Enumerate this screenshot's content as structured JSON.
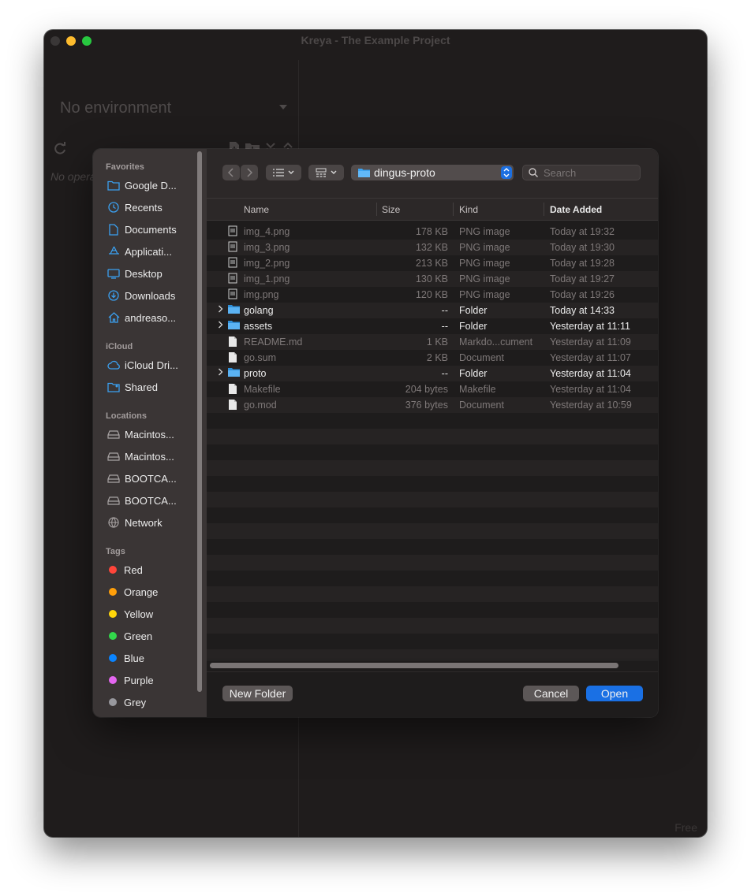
{
  "app": {
    "title": "Kreya - The Example Project",
    "environment": "No environment",
    "no_operations": "No operations",
    "plan_label": "Free"
  },
  "dialog": {
    "sidebar": {
      "favorites_heading": "Favorites",
      "favorites": [
        {
          "label": "Google D...",
          "icon": "folder-icon"
        },
        {
          "label": "Recents",
          "icon": "clock-icon"
        },
        {
          "label": "Documents",
          "icon": "document-icon"
        },
        {
          "label": "Applicati...",
          "icon": "applications-icon"
        },
        {
          "label": "Desktop",
          "icon": "desktop-icon"
        },
        {
          "label": "Downloads",
          "icon": "download-icon"
        },
        {
          "label": "andreaso...",
          "icon": "home-icon"
        }
      ],
      "icloud_heading": "iCloud",
      "icloud": [
        {
          "label": "iCloud Dri...",
          "icon": "cloud-icon"
        },
        {
          "label": "Shared",
          "icon": "shared-folder-icon"
        }
      ],
      "locations_heading": "Locations",
      "locations": [
        {
          "label": "Macintos...",
          "icon": "drive-icon"
        },
        {
          "label": "Macintos...",
          "icon": "drive-icon"
        },
        {
          "label": "BOOTCA...",
          "icon": "drive-icon"
        },
        {
          "label": "BOOTCA...",
          "icon": "drive-icon"
        },
        {
          "label": "Network",
          "icon": "globe-icon"
        }
      ],
      "tags_heading": "Tags",
      "tags": [
        {
          "label": "Red",
          "color": "#ff453a"
        },
        {
          "label": "Orange",
          "color": "#ff9f0a"
        },
        {
          "label": "Yellow",
          "color": "#ffd60a"
        },
        {
          "label": "Green",
          "color": "#32d74b"
        },
        {
          "label": "Blue",
          "color": "#0a84ff"
        },
        {
          "label": "Purple",
          "color": "#e466f0"
        },
        {
          "label": "Grey",
          "color": "#98989d"
        }
      ]
    },
    "toolbar": {
      "current_folder": "dingus-proto",
      "search_placeholder": "Search"
    },
    "columns": {
      "name": "Name",
      "size": "Size",
      "kind": "Kind",
      "date_added": "Date Added"
    },
    "files": [
      {
        "name": "img_4.png",
        "size": "178 KB",
        "kind": "PNG image",
        "date": "Today at 19:32",
        "type": "image"
      },
      {
        "name": "img_3.png",
        "size": "132 KB",
        "kind": "PNG image",
        "date": "Today at 19:30",
        "type": "image"
      },
      {
        "name": "img_2.png",
        "size": "213 KB",
        "kind": "PNG image",
        "date": "Today at 19:28",
        "type": "image"
      },
      {
        "name": "img_1.png",
        "size": "130 KB",
        "kind": "PNG image",
        "date": "Today at 19:27",
        "type": "image"
      },
      {
        "name": "img.png",
        "size": "120 KB",
        "kind": "PNG image",
        "date": "Today at 19:26",
        "type": "image"
      },
      {
        "name": "golang",
        "size": "--",
        "kind": "Folder",
        "date": "Today at 14:33",
        "type": "folder"
      },
      {
        "name": "assets",
        "size": "--",
        "kind": "Folder",
        "date": "Yesterday at 11:11",
        "type": "folder"
      },
      {
        "name": "README.md",
        "size": "1 KB",
        "kind": "Markdo...cument",
        "date": "Yesterday at 11:09",
        "type": "doc"
      },
      {
        "name": "go.sum",
        "size": "2 KB",
        "kind": "Document",
        "date": "Yesterday at 11:07",
        "type": "doc"
      },
      {
        "name": "proto",
        "size": "--",
        "kind": "Folder",
        "date": "Yesterday at 11:04",
        "type": "folder"
      },
      {
        "name": "Makefile",
        "size": "204 bytes",
        "kind": "Makefile",
        "date": "Yesterday at 11:04",
        "type": "doc"
      },
      {
        "name": "go.mod",
        "size": "376 bytes",
        "kind": "Document",
        "date": "Yesterday at 10:59",
        "type": "doc"
      }
    ],
    "buttons": {
      "new_folder": "New Folder",
      "cancel": "Cancel",
      "open": "Open"
    }
  }
}
